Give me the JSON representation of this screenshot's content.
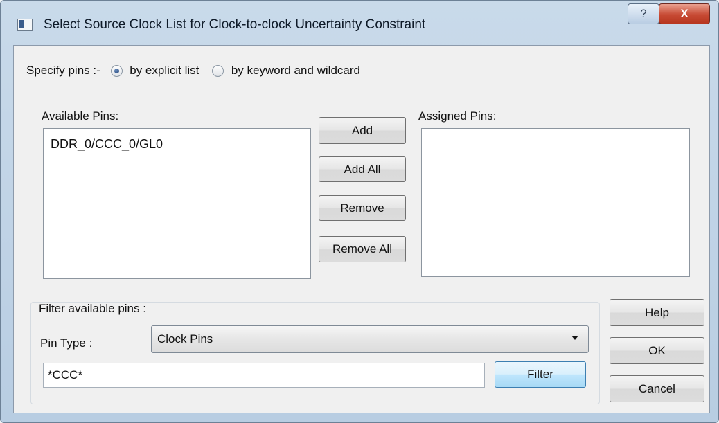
{
  "window": {
    "title": "Select Source Clock List for Clock-to-clock Uncertainty Constraint",
    "help_glyph": "?",
    "close_glyph": "X"
  },
  "specify": {
    "label": "Specify pins :-",
    "options": [
      {
        "label": "by explicit list",
        "selected": true
      },
      {
        "label": "by keyword and wildcard",
        "selected": false
      }
    ]
  },
  "available": {
    "label": "Available Pins:",
    "items": [
      "DDR_0/CCC_0/GL0"
    ]
  },
  "assigned": {
    "label": "Assigned Pins:",
    "items": []
  },
  "transfer_buttons": {
    "add": "Add",
    "add_all": "Add All",
    "remove": "Remove",
    "remove_all": "Remove All"
  },
  "filter": {
    "group_label": "Filter available pins :",
    "pin_type_label": "Pin Type :",
    "pin_type_value": "Clock Pins",
    "pattern_value": "*CCC*",
    "filter_button": "Filter"
  },
  "dialog_buttons": {
    "help": "Help",
    "ok": "OK",
    "cancel": "Cancel"
  },
  "colors": {
    "title_bar": "#c0d4e8",
    "close_button": "#c74a34",
    "client_bg": "#f0f0f0",
    "focus_accent": "#3c7fb1"
  },
  "icons": {
    "app": "dialog-app-icon",
    "help": "help-icon",
    "close": "close-icon",
    "dropdown": "chevron-down-icon"
  }
}
